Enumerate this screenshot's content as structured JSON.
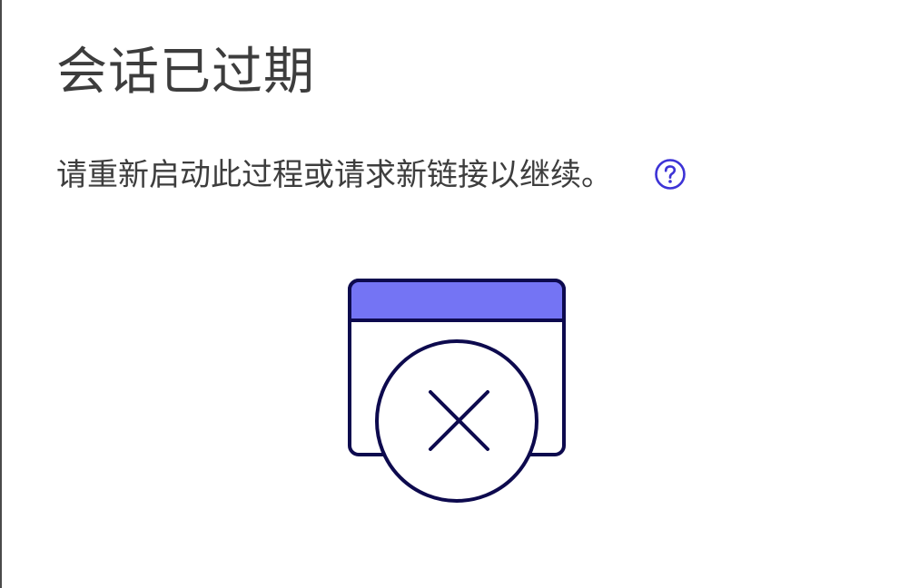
{
  "dialog": {
    "title": "会话已过期",
    "message": "请重新启动此过程或请求新链接以继续。"
  },
  "icons": {
    "help": "help-circle-icon",
    "illustration": "expired-window-x-icon"
  },
  "colors": {
    "accent": "#3d33d6",
    "window_header": "#7474f4",
    "outline": "#0d0a4e",
    "text": "#3d3d3d"
  }
}
